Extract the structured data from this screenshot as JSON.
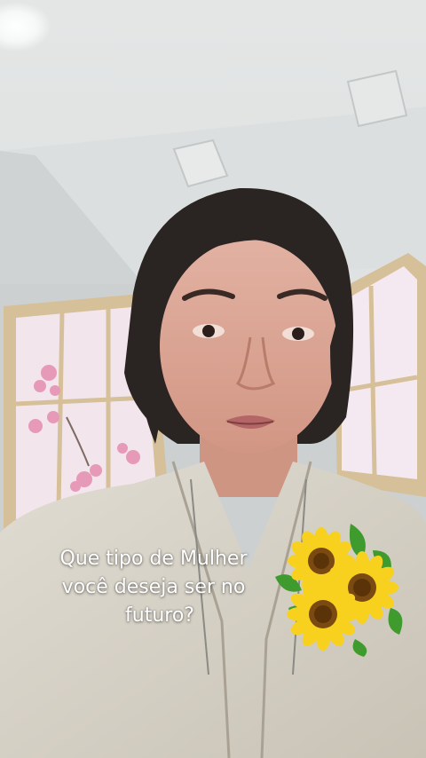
{
  "caption": {
    "line1": "Que tipo de Mulher",
    "line2": "você deseja ser no",
    "line3": "futuro?"
  },
  "sticker": {
    "icon": "sunflower-sticker-icon"
  },
  "colors": {
    "ceiling": "#dfe1e1",
    "wall": "#d4d7d8",
    "screen_frame": "#d6c09a",
    "screen_paper": "#f2e4ec",
    "blossom": "#e69ab8",
    "robe": "#d8d3c8",
    "skin": "#d9a392",
    "hair": "#2a2422",
    "petal": "#f7d11e",
    "seed": "#7a4a12",
    "leaf": "#3f9b2d"
  }
}
